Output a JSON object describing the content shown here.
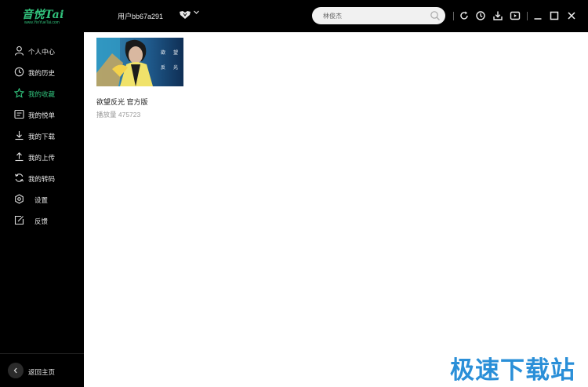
{
  "app": {
    "logo_text": "音悦Tai",
    "logo_sub": "www.YinYueTai.com"
  },
  "header": {
    "username": "用户bb67a291",
    "search": {
      "value": "林俊杰",
      "placeholder": ""
    }
  },
  "sidebar": {
    "items": [
      {
        "label": "个人中心",
        "icon": "user-icon"
      },
      {
        "label": "我的历史",
        "icon": "clock-icon"
      },
      {
        "label": "我的收藏",
        "icon": "star-icon",
        "active": true
      },
      {
        "label": "我的悦单",
        "icon": "playlist-icon"
      },
      {
        "label": "我的下载",
        "icon": "download-icon"
      },
      {
        "label": "我的上传",
        "icon": "upload-icon"
      },
      {
        "label": "我的转码",
        "icon": "convert-icon"
      },
      {
        "label": "设置",
        "icon": "settings-icon"
      },
      {
        "label": "反馈",
        "icon": "feedback-icon"
      }
    ],
    "back_label": "返回主页"
  },
  "content": {
    "videos": [
      {
        "title": "欲望反光 官方版",
        "views": "播放量 475723",
        "thumb_text_1": "欲",
        "thumb_text_2": "望",
        "thumb_text_3": "反",
        "thumb_text_4": "光"
      }
    ]
  },
  "watermark": "极速下载站",
  "colors": {
    "accent": "#31c27c",
    "sidebar_bg": "#000000",
    "watermark": "#2a8fd8"
  }
}
